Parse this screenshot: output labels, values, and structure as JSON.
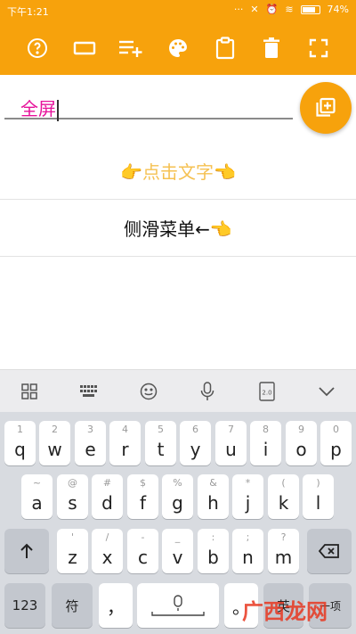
{
  "status": {
    "time": "下午1:21",
    "battery": "74%"
  },
  "toolbar": {
    "buttons": [
      {
        "icon": "help-circle-icon"
      },
      {
        "icon": "rectangle-icon"
      },
      {
        "icon": "playlist-add-icon"
      },
      {
        "icon": "palette-icon"
      },
      {
        "icon": "clipboard-icon"
      },
      {
        "icon": "trash-icon"
      },
      {
        "icon": "fullscreen-icon"
      }
    ]
  },
  "editor": {
    "value": "全屏"
  },
  "fab": {
    "icon": "library-add-icon"
  },
  "list": {
    "item1": "👉点击文字👈",
    "item2": "侧滑菜单←👈"
  },
  "keyboard": {
    "row1": [
      [
        "1",
        "q"
      ],
      [
        "2",
        "w"
      ],
      [
        "3",
        "e"
      ],
      [
        "4",
        "r"
      ],
      [
        "5",
        "t"
      ],
      [
        "6",
        "y"
      ],
      [
        "7",
        "u"
      ],
      [
        "8",
        "i"
      ],
      [
        "9",
        "o"
      ],
      [
        "0",
        "p"
      ]
    ],
    "row2": [
      [
        "~",
        "a"
      ],
      [
        "@",
        "s"
      ],
      [
        "#",
        "d"
      ],
      [
        "$",
        "f"
      ],
      [
        "%",
        "g"
      ],
      [
        "&",
        "h"
      ],
      [
        "*",
        "j"
      ],
      [
        "(",
        "k"
      ],
      [
        ")",
        "l"
      ]
    ],
    "row3": [
      [
        "'",
        "z"
      ],
      [
        "/",
        "x"
      ],
      [
        "-",
        "c"
      ],
      [
        "_",
        "v"
      ],
      [
        ":",
        "b"
      ],
      [
        ";",
        "n"
      ],
      [
        "?",
        "m"
      ]
    ],
    "num_label": "123",
    "symbol_label": "符",
    "comma_label": "，",
    "last_label": "一项"
  },
  "watermark": "广西龙网"
}
